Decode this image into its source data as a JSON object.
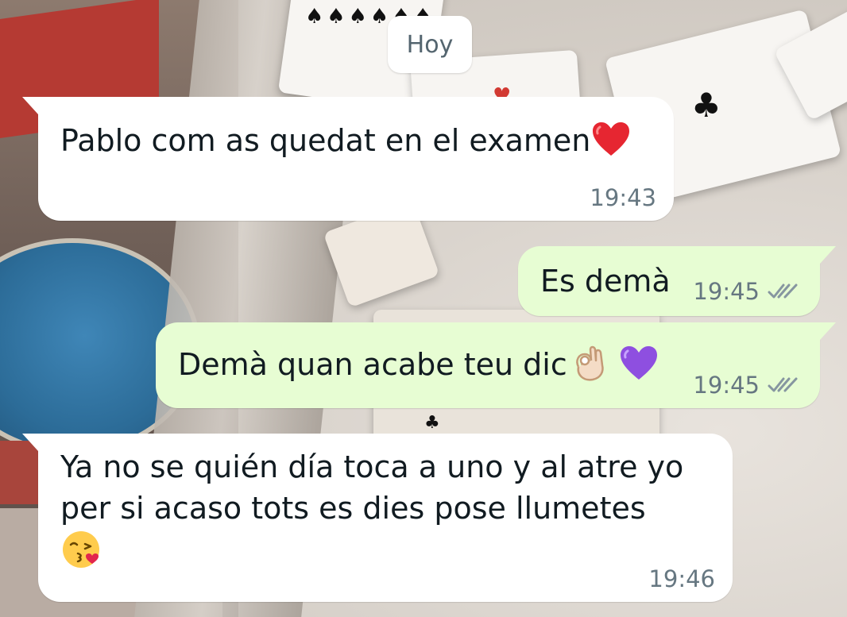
{
  "date_chip": "Hoy",
  "messages": [
    {
      "direction": "incoming",
      "lines": [
        "Pablo com as quedat en el examen"
      ],
      "trailing_emoji": "red-heart-emoji",
      "time": "19:43"
    },
    {
      "direction": "outgoing",
      "lines": [
        "Es demà"
      ],
      "time": "19:45",
      "status": "delivered (double check, grey)"
    },
    {
      "direction": "outgoing",
      "lines": [
        "Demà quan acabe teu dic"
      ],
      "trailing_emoji": [
        "ok-hand-emoji",
        "purple-heart-emoji"
      ],
      "time": "19:45",
      "status": "delivered (double check, grey)"
    },
    {
      "direction": "incoming",
      "lines": [
        "Ya no se quién día toca a uno y al atre yo",
        "per si acaso tots es dies pose llumetes"
      ],
      "trailing_emoji": "kissing-face-with-heart-emoji",
      "time": "19:46"
    }
  ],
  "colors": {
    "incoming_bubble": "#ffffff",
    "outgoing_bubble": "#e7fdd3",
    "text": "#111b21",
    "meta_text": "#667781",
    "tick_color": "#8696a0"
  }
}
